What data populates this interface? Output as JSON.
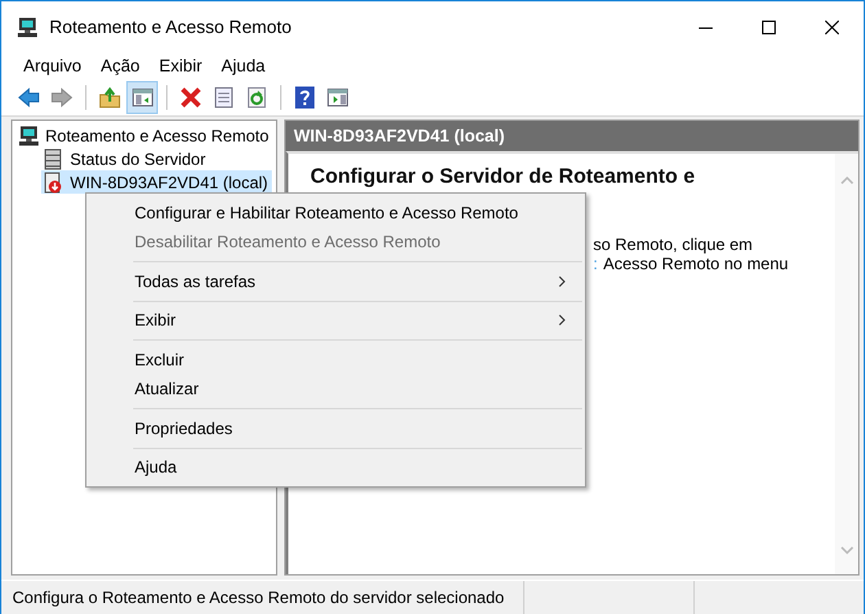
{
  "window": {
    "title": "Roteamento e Acesso Remoto"
  },
  "menu_bar": [
    "Arquivo",
    "Ação",
    "Exibir",
    "Ajuda"
  ],
  "toolbar": [
    {
      "kind": "back",
      "disabled": false,
      "pressed": false
    },
    {
      "kind": "forward",
      "disabled": true,
      "pressed": false
    },
    {
      "kind": "separator"
    },
    {
      "kind": "up",
      "disabled": false,
      "pressed": false
    },
    {
      "kind": "tree",
      "disabled": false,
      "pressed": true
    },
    {
      "kind": "separator"
    },
    {
      "kind": "delete",
      "disabled": false,
      "pressed": false
    },
    {
      "kind": "properties",
      "disabled": false,
      "pressed": false
    },
    {
      "kind": "refresh",
      "disabled": false,
      "pressed": false
    },
    {
      "kind": "separator"
    },
    {
      "kind": "help",
      "disabled": false,
      "pressed": false
    },
    {
      "kind": "action-pane",
      "disabled": false,
      "pressed": false
    }
  ],
  "tree": [
    {
      "label": "Roteamento e Acesso Remoto",
      "kind": "root",
      "selected": false,
      "children": [
        {
          "label": "Status do Servidor",
          "kind": "status",
          "selected": false
        },
        {
          "label": "WIN-8D93AF2VD41 (local)",
          "kind": "server",
          "selected": true
        }
      ]
    }
  ],
  "details": {
    "header": "WIN-8D93AF2VD41 (local)",
    "heading": "Configurar o Servidor de Roteamento e",
    "lines": [
      {
        "text": "so Remoto, clique em"
      },
      {
        "link": ":",
        "text": "Acesso Remoto no menu"
      }
    ]
  },
  "context_menu": [
    {
      "kind": "item",
      "label": "Configurar e Habilitar Roteamento e Acesso Remoto",
      "disabled": false,
      "submenu": false
    },
    {
      "kind": "item",
      "label": "Desabilitar Roteamento e Acesso Remoto",
      "disabled": true,
      "submenu": false
    },
    {
      "kind": "separator"
    },
    {
      "kind": "item",
      "label": "Todas as tarefas",
      "disabled": false,
      "submenu": true
    },
    {
      "kind": "separator"
    },
    {
      "kind": "item",
      "label": "Exibir",
      "disabled": false,
      "submenu": true
    },
    {
      "kind": "separator"
    },
    {
      "kind": "item",
      "label": "Excluir",
      "disabled": false,
      "submenu": false
    },
    {
      "kind": "item",
      "label": "Atualizar",
      "disabled": false,
      "submenu": false
    },
    {
      "kind": "separator"
    },
    {
      "kind": "item",
      "label": "Propriedades",
      "disabled": false,
      "submenu": false
    },
    {
      "kind": "separator"
    },
    {
      "kind": "item",
      "label": "Ajuda",
      "disabled": false,
      "submenu": false
    }
  ],
  "status_bar": {
    "text": "Configura o Roteamento e Acesso Remoto do servidor selecionado"
  }
}
